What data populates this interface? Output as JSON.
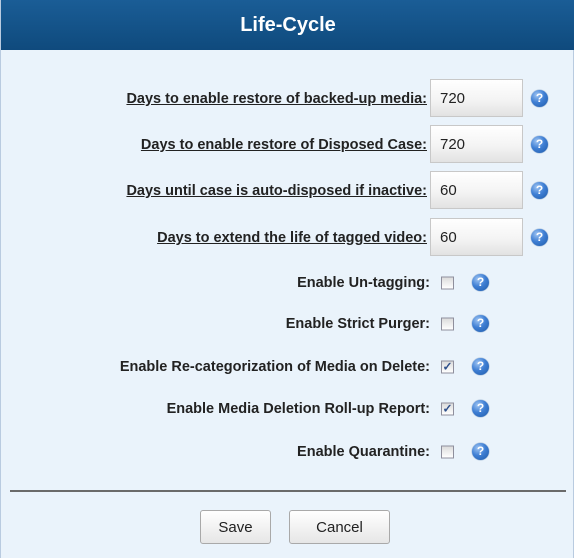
{
  "dialog": {
    "title": "Life-Cycle"
  },
  "fields": [
    {
      "label": "Days to enable restore of backed-up media:",
      "value": "720"
    },
    {
      "label": "Days to enable restore of Disposed Case:",
      "value": "720"
    },
    {
      "label": "Days until case is auto-disposed if inactive:",
      "value": "60"
    },
    {
      "label": "Days to extend the life of tagged video:",
      "value": "60"
    }
  ],
  "checkboxes": [
    {
      "label": "Enable Un-tagging:",
      "checked": false
    },
    {
      "label": "Enable Strict Purger:",
      "checked": false
    },
    {
      "label": "Enable Re-categorization of Media on Delete:",
      "checked": true
    },
    {
      "label": "Enable Media Deletion Roll-up Report:",
      "checked": true
    },
    {
      "label": "Enable Quarantine:",
      "checked": false
    }
  ],
  "help_icon": {
    "glyph": "?",
    "name": "help-icon",
    "color": "#3f7fd4"
  },
  "buttons": {
    "save_label": "Save",
    "cancel_label": "Cancel"
  },
  "colors": {
    "title_bar": "#1a5d96",
    "panel_background": "#eaf3fb",
    "check_mark": "#2d4f8a"
  }
}
